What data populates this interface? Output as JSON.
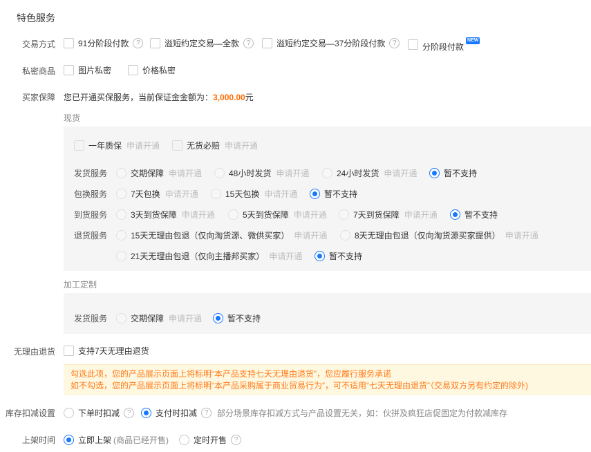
{
  "section_title": "特色服务",
  "trade": {
    "label": "交易方式",
    "options": [
      "91分阶段付款",
      "溢短约定交易—全款",
      "溢短约定交易—37分阶段付款",
      "分阶段付款"
    ],
    "new_badge": "NEW"
  },
  "private": {
    "label": "私密商品",
    "options": [
      "图片私密",
      "价格私密"
    ]
  },
  "buyer": {
    "label": "买家保障",
    "text_prefix": "您已开通买保服务，当前保证金金额为：",
    "amount": "3,000.00",
    "unit": "元"
  },
  "spot": {
    "head": "现货",
    "top_options": [
      "一年质保",
      "无货必赔"
    ],
    "apply_label": "申请开通",
    "rows": [
      {
        "label": "发货服务",
        "options": [
          "交期保障",
          "48小时发货",
          "24小时发货"
        ],
        "none": "暂不支持"
      },
      {
        "label": "包换服务",
        "options": [
          "7天包换",
          "15天包换"
        ],
        "none": "暂不支持"
      },
      {
        "label": "到货服务",
        "options": [
          "3天到货保障",
          "5天到货保障",
          "7天到货保障"
        ],
        "none": "暂不支持"
      },
      {
        "label": "退货服务",
        "options": [
          "15天无理由包退（仅向淘货源、微供买家）",
          "8天无理由包退（仅向淘货源买家提供）",
          "21天无理由包退（仅向主播邦买家）"
        ],
        "none": "暂不支持"
      }
    ]
  },
  "custom": {
    "head": "加工定制",
    "row_label": "发货服务",
    "option": "交期保障",
    "none": "暂不支持"
  },
  "no_reason": {
    "label": "无理由退货",
    "checkbox": "支持7天无理由退货",
    "notice_line1": "勾选此项，您的产品展示页面上将标明“本产品支持七天无理由退货”，您应履行服务承诺",
    "notice_line2": "如不勾选，您的产品展示页面上将标明“本产品采购属于商业贸易行为”，可不适用“七天无理由退货”（交易双方另有约定的除外)"
  },
  "stock": {
    "label": "库存扣减设置",
    "option1": "下单时扣减",
    "option2": "支付时扣减",
    "hint": "部分场景库存扣减方式与产品设置无关，如：伙拼及疯狂店促固定为付款减库存"
  },
  "shelf": {
    "label": "上架时间",
    "option1": "立即上架",
    "option1_hint": "(商品已经开售)",
    "option2": "定时开售"
  },
  "colors": {
    "accent": "#1677ff",
    "orange": "#ff6a00",
    "notice_bg": "#fff8e1",
    "box_bg": "#f5f5f5"
  }
}
